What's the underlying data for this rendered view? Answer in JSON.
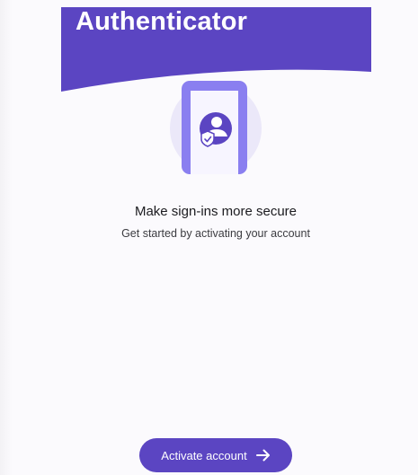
{
  "header": {
    "title": "Authenticator"
  },
  "main": {
    "headline": "Make sign-ins more secure",
    "subtext": "Get started by activating your account"
  },
  "footer": {
    "activate_label": "Activate account",
    "activate_icon": "arrow-right-icon"
  },
  "colors": {
    "brand_purple": "#5b45c2",
    "illustration_circle": "#ebe8f9",
    "phone_body": "#8a7ff0",
    "phone_screen": "#f7f5ff"
  }
}
